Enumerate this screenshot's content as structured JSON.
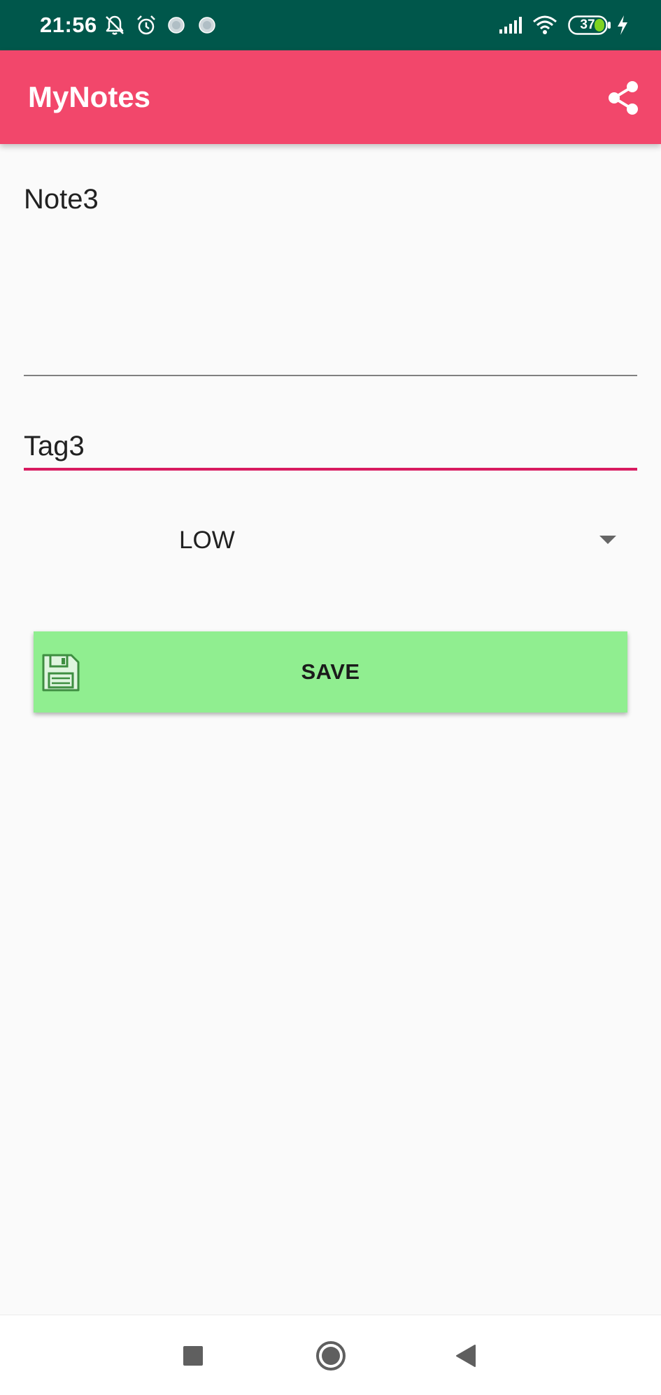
{
  "status_bar": {
    "time": "21:56",
    "battery_level": "37",
    "icons": [
      "notifications-off-icon",
      "alarm-icon",
      "app-notification-icon",
      "app-notification-icon",
      "cellular-signal-icon",
      "wifi-icon",
      "battery-icon",
      "charging-bolt-icon"
    ]
  },
  "app_bar": {
    "title": "MyNotes",
    "action_icon": "share-icon",
    "color": "#f2476b"
  },
  "form": {
    "note_text": "Note3",
    "tag_text": "Tag3",
    "tag_underline_color": "#d81b60",
    "priority": {
      "selected": "LOW"
    },
    "save_button": {
      "label": "SAVE",
      "icon": "floppy-disk-icon",
      "color": "#90ee90"
    }
  },
  "nav_bar": {
    "buttons": [
      "recents-square-icon",
      "home-circle-icon",
      "back-triangle-icon"
    ]
  }
}
